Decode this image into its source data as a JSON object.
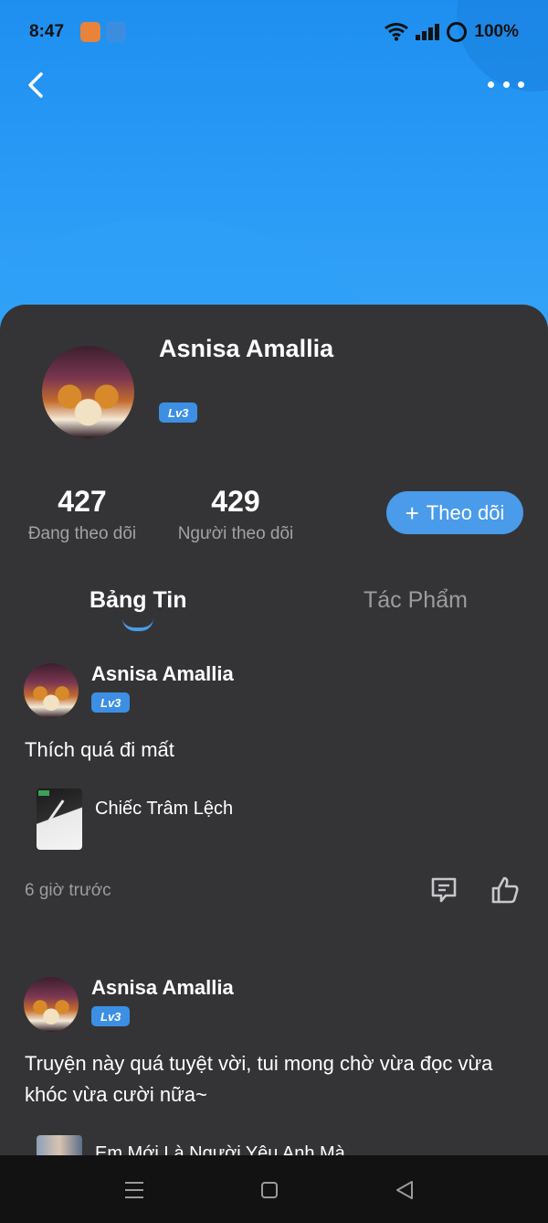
{
  "status_bar": {
    "time": "8:47",
    "battery": "100%",
    "icons": [
      "app-icon",
      "novel-app-icon",
      "wifi-icon",
      "signal-icon",
      "battery-icon"
    ]
  },
  "colors": {
    "header": "#2b9cf6",
    "background": "#343436",
    "accent": "#4a9bea",
    "badge": "#3d8fe3"
  },
  "profile": {
    "name": "Asnisa Amallia",
    "level": "Lv3",
    "following_count": "427",
    "following_label": "Đang theo dõi",
    "followers_count": "429",
    "followers_label": "Người theo dõi",
    "follow_button": "Theo dõi",
    "follow_icon": "+"
  },
  "tabs": [
    {
      "label": "Bảng Tin",
      "active": true
    },
    {
      "label": "Tác Phẩm",
      "active": false
    }
  ],
  "posts": [
    {
      "author": "Asnisa Amallia",
      "level": "Lv3",
      "text": "Thích quá đi mất",
      "book_title": "Chiếc Trâm Lệch",
      "time": "6 giờ trước"
    },
    {
      "author": "Asnisa Amallia",
      "level": "Lv3",
      "text": "Truyện này quá tuyệt vời, tui mong chờ vừa đọc vừa khóc vừa cười nữa~",
      "book_title": "Em Mới Là Người Yêu Anh Mà"
    }
  ],
  "nav_bar": {
    "icons": [
      "menu-icon",
      "home-icon",
      "back-triangle-icon"
    ]
  }
}
